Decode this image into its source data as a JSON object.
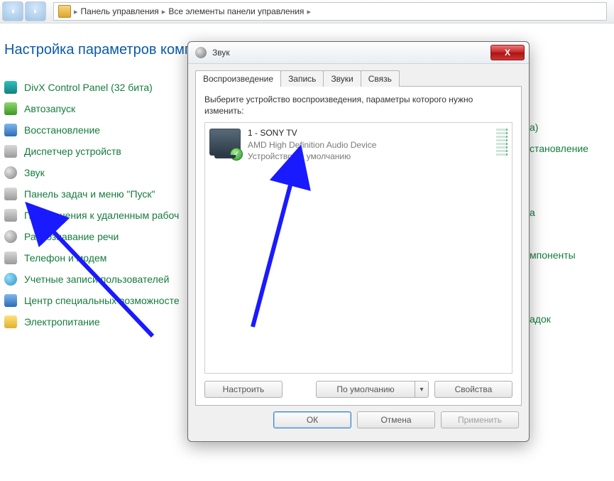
{
  "breadcrumb": {
    "item1": "Панель управления",
    "item2": "Все элементы панели управления"
  },
  "cp": {
    "heading": "Настройка параметров комп",
    "items": [
      {
        "label": "DivX Control Panel (32 бита)",
        "icon": "ic-teal"
      },
      {
        "label": "Автозапуск",
        "icon": "ic-green"
      },
      {
        "label": "Восстановление",
        "icon": "ic-blue"
      },
      {
        "label": "Диспетчер устройств",
        "icon": "ic-gray"
      },
      {
        "label": "Звук",
        "icon": "ic-round"
      },
      {
        "label": "Панель задач и меню \"Пуск\"",
        "icon": "ic-gray"
      },
      {
        "label": "Подключения к удаленным рабоч",
        "icon": "ic-gray"
      },
      {
        "label": "Распознавание речи",
        "icon": "ic-round"
      },
      {
        "label": "Телефон и модем",
        "icon": "ic-gray"
      },
      {
        "label": "Учетные записи пользователей",
        "icon": "ic-users"
      },
      {
        "label": "Центр специальных возможносте",
        "icon": "ic-blue"
      },
      {
        "label": "Электропитание",
        "icon": "ic-yellow"
      }
    ]
  },
  "right_links": {
    "r0": "а)",
    "r1": "становление",
    "r4": "а",
    "r6": "мпоненты",
    "r9": "адок"
  },
  "sound": {
    "title": "Звук",
    "tabs": {
      "t0": "Воспроизведение",
      "t1": "Запись",
      "t2": "Звуки",
      "t3": "Связь"
    },
    "instruction": "Выберите устройство воспроизведения, параметры которого нужно изменить:",
    "device": {
      "name": "1 - SONY TV",
      "line2": "AMD High Definition Audio Device",
      "line3": "Устройство по умолчанию"
    },
    "buttons": {
      "configure": "Настроить",
      "default": "По умолчанию",
      "properties": "Свойства",
      "ok": "ОК",
      "cancel": "Отмена",
      "apply": "Применить"
    }
  }
}
